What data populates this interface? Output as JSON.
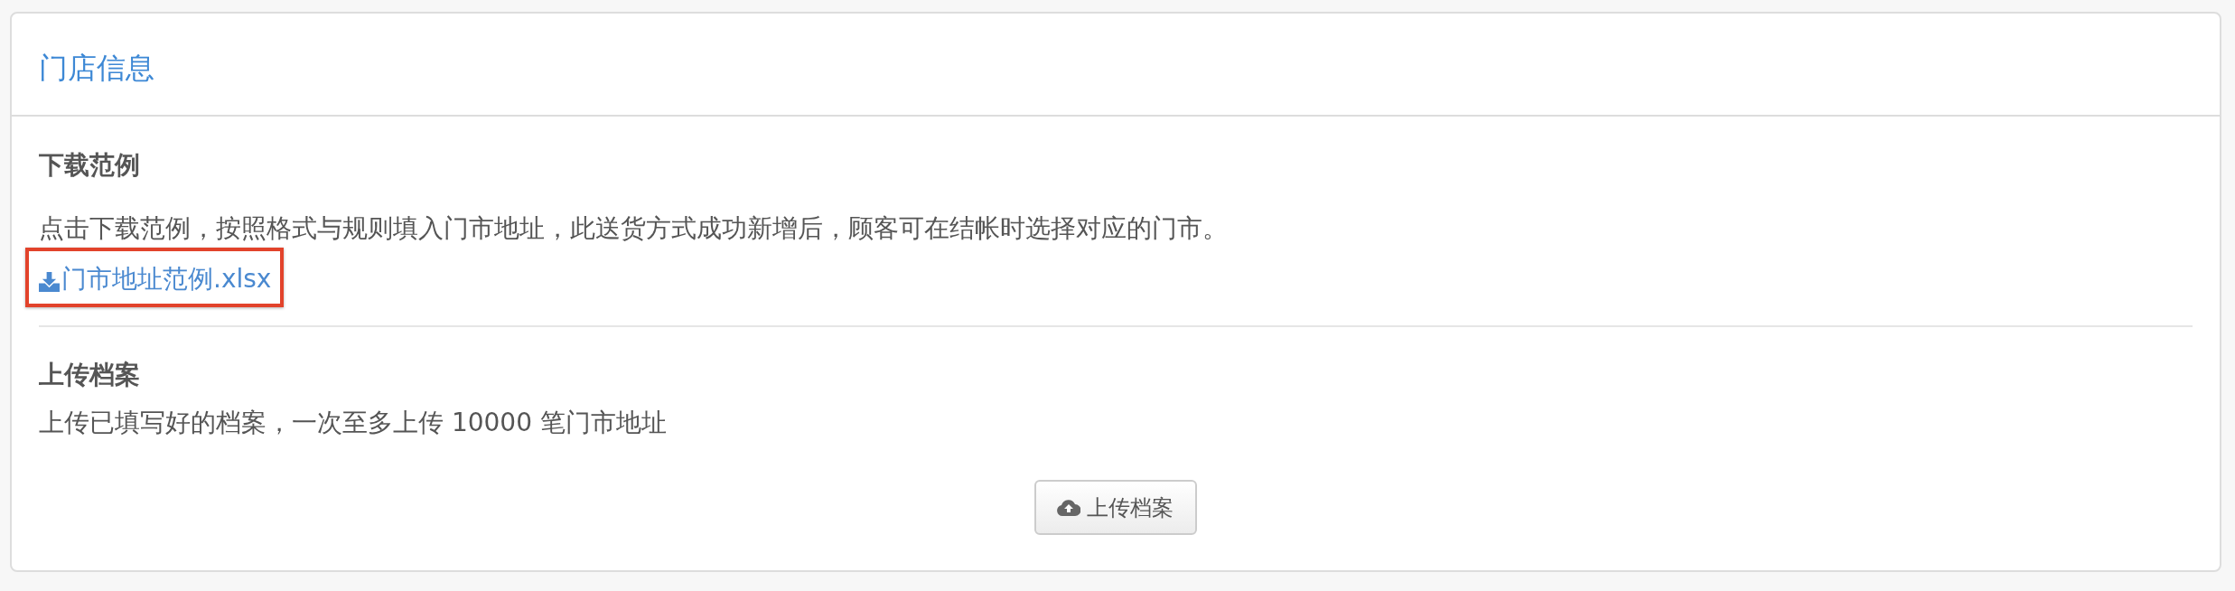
{
  "panel": {
    "title": "门店信息"
  },
  "sections": [
    {
      "kind": "download",
      "heading": "下载范例",
      "description": "点击下载范例，按照格式与规则填入门市地址，此送货方式成功新增后，顾客可在结帐时选择对应的门市。",
      "link": {
        "label": "门市地址范例.xlsx",
        "highlighted": true
      }
    },
    {
      "kind": "upload",
      "heading": "上传档案",
      "description": "上传已填写好的档案，一次至多上传 10000 笔门市地址",
      "button": {
        "label": "上传档案"
      }
    }
  ]
}
